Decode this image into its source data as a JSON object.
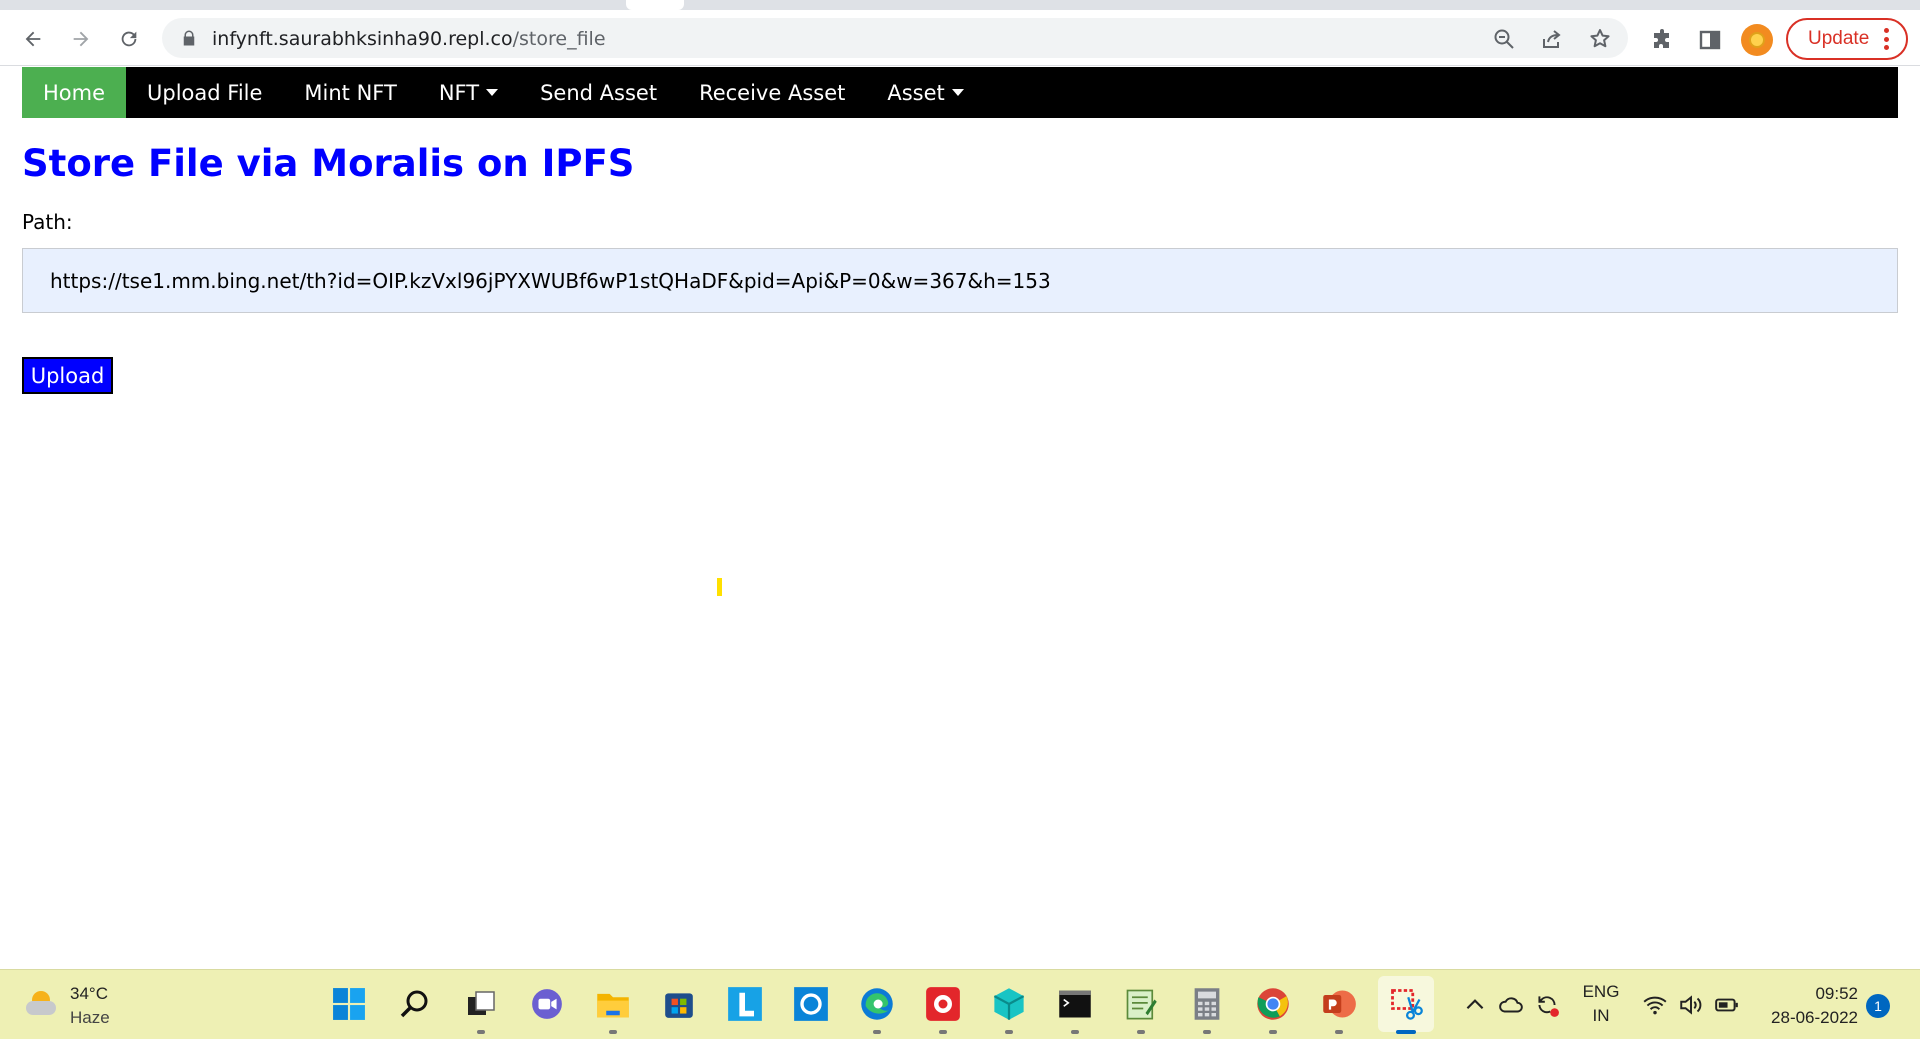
{
  "browser": {
    "url_domain": "infynft.saurabhksinha90.repl.co",
    "url_path": "/store_file",
    "update_label": "Update"
  },
  "navbar": {
    "items": [
      {
        "label": "Home",
        "active": true
      },
      {
        "label": "Upload File"
      },
      {
        "label": "Mint NFT"
      },
      {
        "label": "NFT",
        "dropdown": true
      },
      {
        "label": "Send Asset"
      },
      {
        "label": "Receive Asset"
      },
      {
        "label": "Asset",
        "dropdown": true
      }
    ]
  },
  "main": {
    "title": "Store File via Moralis on IPFS",
    "path_label": "Path:",
    "path_value": "https://tse1.mm.bing.net/th?id=OIP.kzVxl96jPYXWUBf6wP1stQHaDF&pid=Api&P=0&w=367&h=153",
    "upload_label": "Upload"
  },
  "colors": {
    "title": "#0000ff",
    "nav_active": "#4caf50",
    "upload_bg": "#0000ff",
    "input_bg": "#e8f0fe"
  },
  "taskbar": {
    "temperature": "34°C",
    "condition": "Haze",
    "apps": [
      "windows-start",
      "search",
      "task-view",
      "teams-chat",
      "file-explorer",
      "microsoft-store",
      "launcher-l",
      "cortana",
      "edge",
      "cast-app",
      "3d-viewer",
      "terminal",
      "notepad",
      "calculator",
      "chrome",
      "powerpoint",
      "snipping-tool"
    ],
    "language": "ENG",
    "region": "IN",
    "time": "09:52",
    "date": "28-06-2022",
    "notification_count": "1"
  }
}
